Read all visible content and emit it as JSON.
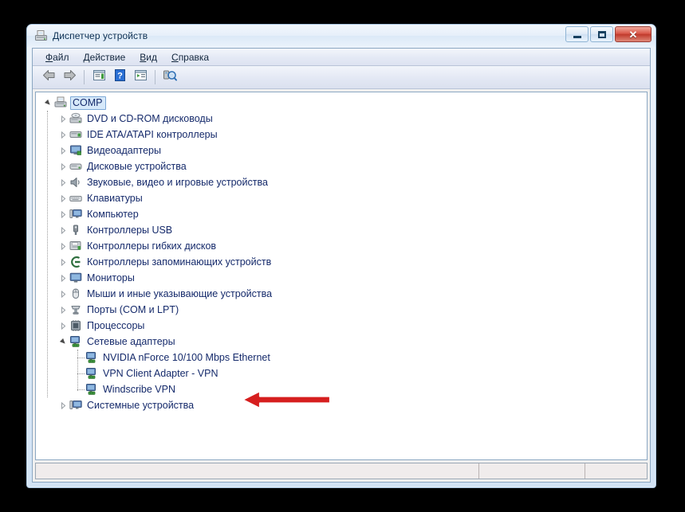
{
  "window": {
    "title": "Диспетчер устройств",
    "title_icon": "device-manager-icon",
    "minimize_label": "",
    "maximize_label": "",
    "close_label": "✕"
  },
  "menubar": {
    "items": [
      {
        "accel": "Ф",
        "rest": "айл",
        "name": "menu-file"
      },
      {
        "accel": "Д",
        "rest": "ействие",
        "name": "menu-action"
      },
      {
        "accel": "В",
        "rest": "ид",
        "name": "menu-view"
      },
      {
        "accel": "С",
        "rest": "правка",
        "name": "menu-help"
      }
    ]
  },
  "toolbar": {
    "buttons": [
      {
        "icon": "back-arrow-icon",
        "name": "toolbar-back"
      },
      {
        "icon": "forward-arrow-icon",
        "name": "toolbar-forward"
      },
      {
        "icon": "separator",
        "name": "toolbar-separator-1"
      },
      {
        "icon": "properties-icon",
        "name": "toolbar-properties"
      },
      {
        "icon": "help-icon",
        "name": "toolbar-help"
      },
      {
        "icon": "scan-list-icon",
        "name": "toolbar-show-hidden"
      },
      {
        "icon": "separator",
        "name": "toolbar-separator-2"
      },
      {
        "icon": "scan-hardware-icon",
        "name": "toolbar-scan-hardware"
      }
    ]
  },
  "tree": {
    "root": {
      "label": "COMP",
      "icon": "computer-icon",
      "expanded": true,
      "selected": true
    },
    "categories": [
      {
        "label": "DVD и CD-ROM дисководы",
        "icon": "dvd-icon",
        "expanded": false
      },
      {
        "label": "IDE ATA/ATAPI контроллеры",
        "icon": "ide-controller-icon",
        "expanded": false
      },
      {
        "label": "Видеоадаптеры",
        "icon": "display-adapter-icon",
        "expanded": false
      },
      {
        "label": "Дисковые устройства",
        "icon": "disk-drive-icon",
        "expanded": false
      },
      {
        "label": "Звуковые, видео и игровые устройства",
        "icon": "sound-icon",
        "expanded": false
      },
      {
        "label": "Клавиатуры",
        "icon": "keyboard-icon",
        "expanded": false
      },
      {
        "label": "Компьютер",
        "icon": "computer-node-icon",
        "expanded": false
      },
      {
        "label": "Контроллеры USB",
        "icon": "usb-icon",
        "expanded": false
      },
      {
        "label": "Контроллеры гибких дисков",
        "icon": "floppy-controller-icon",
        "expanded": false
      },
      {
        "label": "Контроллеры запоминающих устройств",
        "icon": "storage-controller-icon",
        "expanded": false
      },
      {
        "label": "Мониторы",
        "icon": "monitor-icon",
        "expanded": false
      },
      {
        "label": "Мыши и иные указывающие устройства",
        "icon": "mouse-icon",
        "expanded": false
      },
      {
        "label": "Порты (COM и LPT)",
        "icon": "port-icon",
        "expanded": false
      },
      {
        "label": "Процессоры",
        "icon": "processor-icon",
        "expanded": false
      },
      {
        "label": "Сетевые адаптеры",
        "icon": "network-adapter-icon",
        "expanded": true
      },
      {
        "label": "Системные устройства",
        "icon": "system-device-icon",
        "expanded": false
      }
    ],
    "network_children": [
      {
        "label": "NVIDIA nForce 10/100 Mbps Ethernet",
        "icon": "network-adapter-icon"
      },
      {
        "label": "VPN Client Adapter - VPN",
        "icon": "network-adapter-icon"
      },
      {
        "label": "Windscribe VPN",
        "icon": "network-adapter-icon"
      }
    ]
  },
  "statusbar": {
    "panes": [
      "",
      "",
      ""
    ]
  },
  "annotation": {
    "arrow_color": "#d61f1f",
    "arrow_outline": "#ffffff",
    "points_to": "Сетевые адаптеры"
  },
  "colors": {
    "tree_text": "#152a6b",
    "selection_fill": "#d7e9fa",
    "selection_border": "#7ca8d6",
    "window_frame": "#a8c4e0",
    "close_button": "#c03a2c",
    "desktop_background": "#000000"
  }
}
